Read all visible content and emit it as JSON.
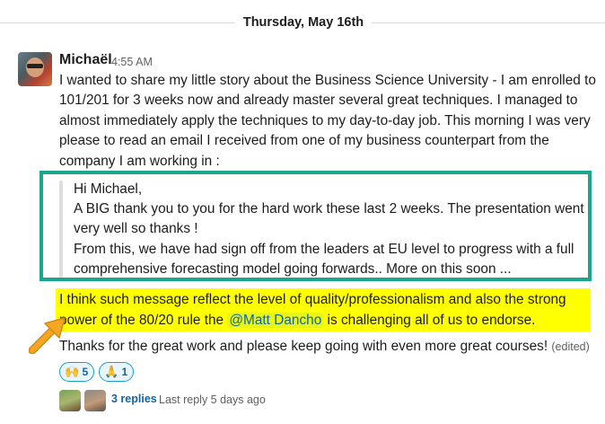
{
  "date_divider": "Thursday, May 16th",
  "message": {
    "author": "Michaël",
    "time": "4:55 AM",
    "body": "I wanted to share my little story about the Business Science University - I am enrolled to 101/201 for 3 weeks now and already master several great techniques. I managed to almost immediately apply the techniques to my day-to-day job. This morning I was very please to read an email I received from one of my business counterpart from the company I am working in :",
    "quote_lines": [
      "Hi Michael,",
      "A BIG thank you to you for the hard work these last 2 weeks. The presentation went very well so thanks !",
      "From this, we have had sign off from the leaders at EU level to progress with a full comprehensive forecasting model going forwards.. More on this soon ..."
    ],
    "highlight_before": "I think such message reflect the level of quality/professionalism and also the strong power of the 80/20 rule the ",
    "mention": "@Matt Dancho",
    "highlight_after": " is challenging all of us to endorse.",
    "closing": "Thanks for the great work and please keep going with even more great courses!",
    "edited_label": "(edited)"
  },
  "reactions": [
    {
      "icon": "raised-hands",
      "emoji": "🙌",
      "count": "5"
    },
    {
      "icon": "pray",
      "emoji": "🙏",
      "count": "1"
    }
  ],
  "thread": {
    "replies_label": "3 replies",
    "last_reply": "Last reply 5 days ago"
  },
  "colors": {
    "annotation_frame": "#19a58e",
    "highlight": "#ffff00",
    "arrow": "#f5a623",
    "link": "#1264a3"
  }
}
